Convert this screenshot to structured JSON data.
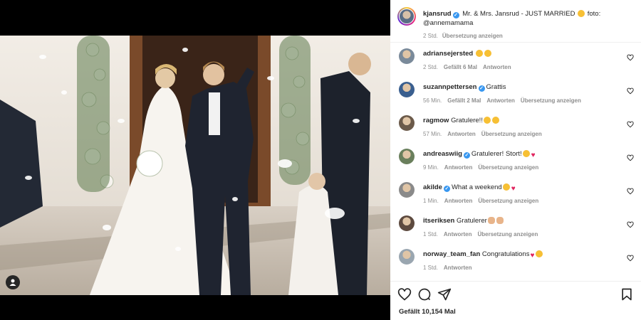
{
  "post": {
    "author": "kjansrud",
    "caption": "Mr. & Mrs. Jansrud - JUST MARRIED",
    "caption_suffix": "foto:",
    "caption_credit": "@annemamama",
    "time": "2 Std.",
    "translate_label": "Übersetzung anzeigen",
    "likes": "Gefällt 10,154 Mal"
  },
  "comments": [
    {
      "user": "adriansejersted",
      "verified": false,
      "text": "",
      "emojis": [
        "heart-eyes",
        "heart-eyes"
      ],
      "time": "2 Std.",
      "likes": "Gefällt 6 Mal",
      "reply": "Antworten",
      "translate": ""
    },
    {
      "user": "suzannpettersen",
      "verified": true,
      "text": "Grattis",
      "emojis": [],
      "time": "56 Min.",
      "likes": "Gefällt 2 Mal",
      "reply": "Antworten",
      "translate": "Übersetzung anzeigen"
    },
    {
      "user": "ragmow",
      "verified": false,
      "text": "Gratulere!!",
      "emojis": [
        "party",
        "heart-eyes"
      ],
      "time": "57 Min.",
      "likes": "",
      "reply": "Antworten",
      "translate": "Übersetzung anzeigen"
    },
    {
      "user": "andreaswiig",
      "verified": true,
      "text": "Gratulerer! Stort!",
      "emojis": [
        "heart-eyes",
        "heart"
      ],
      "time": "9 Min.",
      "likes": "",
      "reply": "Antworten",
      "translate": "Übersetzung anzeigen"
    },
    {
      "user": "akilde",
      "verified": true,
      "text": "What a weekend",
      "emojis": [
        "heart-eyes",
        "heart"
      ],
      "time": "1 Min.",
      "likes": "",
      "reply": "Antworten",
      "translate": "Übersetzung anzeigen"
    },
    {
      "user": "itseriksen",
      "verified": false,
      "text": "Gratulerer",
      "emojis": [
        "clap",
        "clap"
      ],
      "time": "1 Std.",
      "likes": "",
      "reply": "Antworten",
      "translate": "Übersetzung anzeigen"
    },
    {
      "user": "norway_team_fan",
      "verified": false,
      "text": "Congratulations",
      "emojis": [
        "heart",
        "heart-eyes"
      ],
      "time": "1 Std.",
      "likes": "",
      "reply": "Antworten",
      "translate": ""
    }
  ],
  "icons": {
    "like": "heart-icon",
    "comment": "comment-icon",
    "share": "share-icon",
    "save": "bookmark-icon",
    "tag": "person-tag-icon"
  },
  "colors": {
    "verified": "#3897f0",
    "text": "#262626",
    "meta": "#8e8e8e"
  }
}
